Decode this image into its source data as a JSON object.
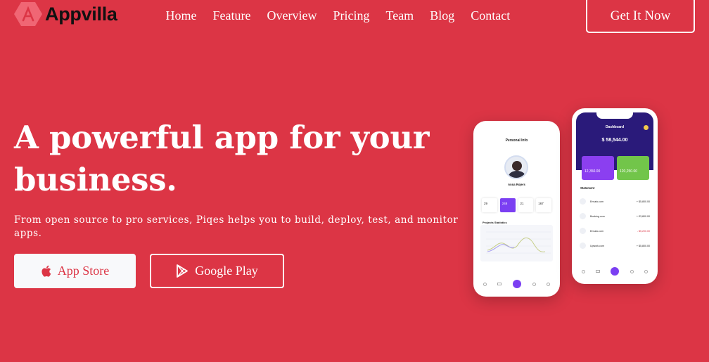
{
  "header": {
    "logo_text": "Appvilla",
    "nav": [
      "Home",
      "Feature",
      "Overview",
      "Pricing",
      "Team",
      "Blog",
      "Contact"
    ],
    "cta_label": "Get It Now"
  },
  "hero": {
    "headline": "A powerful app for your business.",
    "subtext": "From open source to pro services, Piqes helps you to build, deploy, test, and monitor apps.",
    "app_store_label": "App Store",
    "google_play_label": "Google Play"
  },
  "phone_profile": {
    "title": "Personal Info",
    "name": "Anna Rojers",
    "stats": [
      "29",
      "248",
      "21",
      "167"
    ],
    "chart_title": "Projects Statistics"
  },
  "phone_dashboard": {
    "title": "Dashboard",
    "balance": "$ 58,544.00",
    "card_left": "12,350.00",
    "card_right": "120,250.00",
    "statement_title": "Statement",
    "rows": [
      {
        "name": "Envato.com",
        "amount": "+ $5,800.00"
      },
      {
        "name": "Booking.com",
        "amount": "+ €3,800.00"
      },
      {
        "name": "Envato.com",
        "amount": "- $5,200.00"
      },
      {
        "name": "Upwork.com",
        "amount": "+ $5,800.00"
      }
    ]
  },
  "colors": {
    "background": "#dc3545",
    "accent_purple": "#7b3ff2",
    "accent_green": "#72c54a",
    "dark_header": "#2a1a7a"
  }
}
